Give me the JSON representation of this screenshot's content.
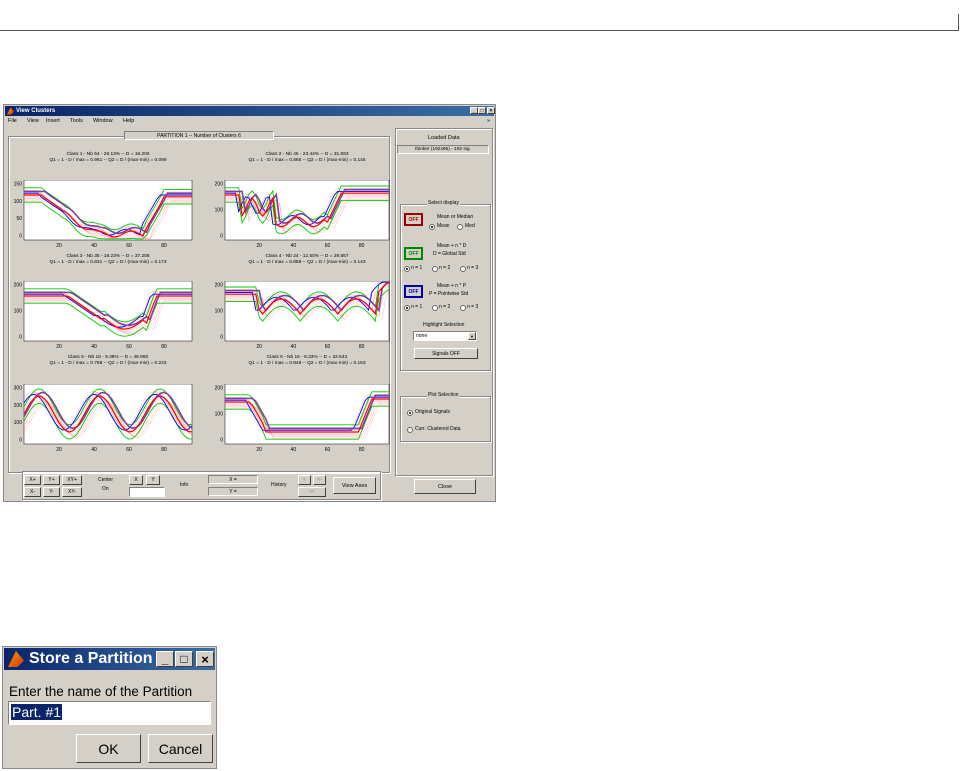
{
  "main_window": {
    "title": "View Clusters",
    "menu": [
      "File",
      "View",
      "Insert",
      "Tools",
      "Window",
      "Help"
    ],
    "menu_arrow": "»",
    "partition_label": "PARTITION 1  --  Number of Clusters 6",
    "classes": [
      {
        "title": "Class 1  -  Nb 54  -  28.13%  --  D = 16.206",
        "subtitle": "Q1 = 1 - D / max = 0.961  --  Q2 = D / (max-min) = 0.099",
        "yticks": [
          "150",
          "100",
          "50",
          "0"
        ],
        "xticks": [
          "20",
          "40",
          "60",
          "80"
        ]
      },
      {
        "title": "Class 2  -  Nb 45  -  23.44%  --  D = 31.693",
        "subtitle": "Q1 = 1 - D / max = 0.866  --  Q2 = D / (max-min) = 0.145",
        "yticks": [
          "200",
          "100",
          "0"
        ],
        "xticks": [
          "20",
          "40",
          "60",
          "80"
        ]
      },
      {
        "title": "Class 3  -  Nb 35  -  18.23%  --  D = 37.208",
        "subtitle": "Q1 = 1 - D / max = 0.831  --  Q2 = D / (max-min) = 0.173",
        "yticks": [
          "200",
          "100",
          "0"
        ],
        "xticks": [
          "20",
          "40",
          "60",
          "80"
        ]
      },
      {
        "title": "Class 4  -  Nb 24  -  12.50%  --  D = 29.557",
        "subtitle": "Q1 = 1 - D / max = 0.858  --  Q2 = D / (max-min) = 0.143",
        "yticks": [
          "200",
          "100",
          "0"
        ],
        "xticks": [
          "20",
          "40",
          "60",
          "80"
        ]
      },
      {
        "title": "Class 5  -  Nb 18  -  9.38%  --  D = 48.950",
        "subtitle": "Q1 = 1 - D / max = 0.768  --  Q2 = D / (max-min) = 0.233",
        "yticks": [
          "300",
          "200",
          "100",
          "0"
        ],
        "xticks": [
          "20",
          "40",
          "60",
          "80"
        ]
      },
      {
        "title": "Class 6  -  Nb 16  -  8.33%  --  D = 32.543",
        "subtitle": "Q1 = 1 - D / max = 0.848  --  Q2 = D / (max-min) = 0.153",
        "yticks": [
          "200",
          "100",
          "0"
        ],
        "xticks": [
          "20",
          "40",
          "60",
          "80"
        ]
      }
    ],
    "loaded_data": {
      "label": "Loaded Data",
      "value": "thinker (192x96) - 192 sig."
    },
    "select_display": {
      "label": "Select display",
      "off": "OFF",
      "mean_median": {
        "title": "Mean or Median",
        "opt1": "Mean",
        "opt2": "Med"
      },
      "global_std": {
        "title": "Mean  +  n * D",
        "sub": "D = Global Std"
      },
      "pointwise_std": {
        "title": "Mean  +  n * P",
        "sub": "P = Pointwise Std"
      },
      "n_options": [
        "n = 1",
        "n = 2",
        "n = 3"
      ],
      "highlight_label": "Highlight Selection",
      "highlight_value": "none",
      "signals_off": "Signals OFF"
    },
    "plot_selection": {
      "label": "Plot Selection",
      "opt1": "Original Signals",
      "opt2": "Curr. Clustered Data"
    },
    "close": "Close",
    "toolbar": {
      "nav": [
        "X+",
        "Y+",
        "XY+",
        "X-",
        "Y-",
        "XY-"
      ],
      "center_label": "Center",
      "on_label": "On",
      "x_btn": "X",
      "y_btn": "Y",
      "info_label": "Info",
      "x_eq": "X =",
      "y_eq": "Y =",
      "history_label": "History",
      "hist_btn1": "<",
      "hist_btn2": "<-",
      "hist_btn3": "<<",
      "view_axes": "View Axes"
    }
  },
  "dialog": {
    "title": "Store a Partition",
    "prompt": "Enter the name of the Partition",
    "input_value": "Part. #1",
    "ok": "OK",
    "cancel": "Cancel"
  },
  "colors": {
    "title_blue": "#0a246a",
    "signal": "#ff8080",
    "mean": "#ff0000",
    "envelope": "#00cc00",
    "highlight": "#0000ff",
    "purple": "#8040a0"
  }
}
